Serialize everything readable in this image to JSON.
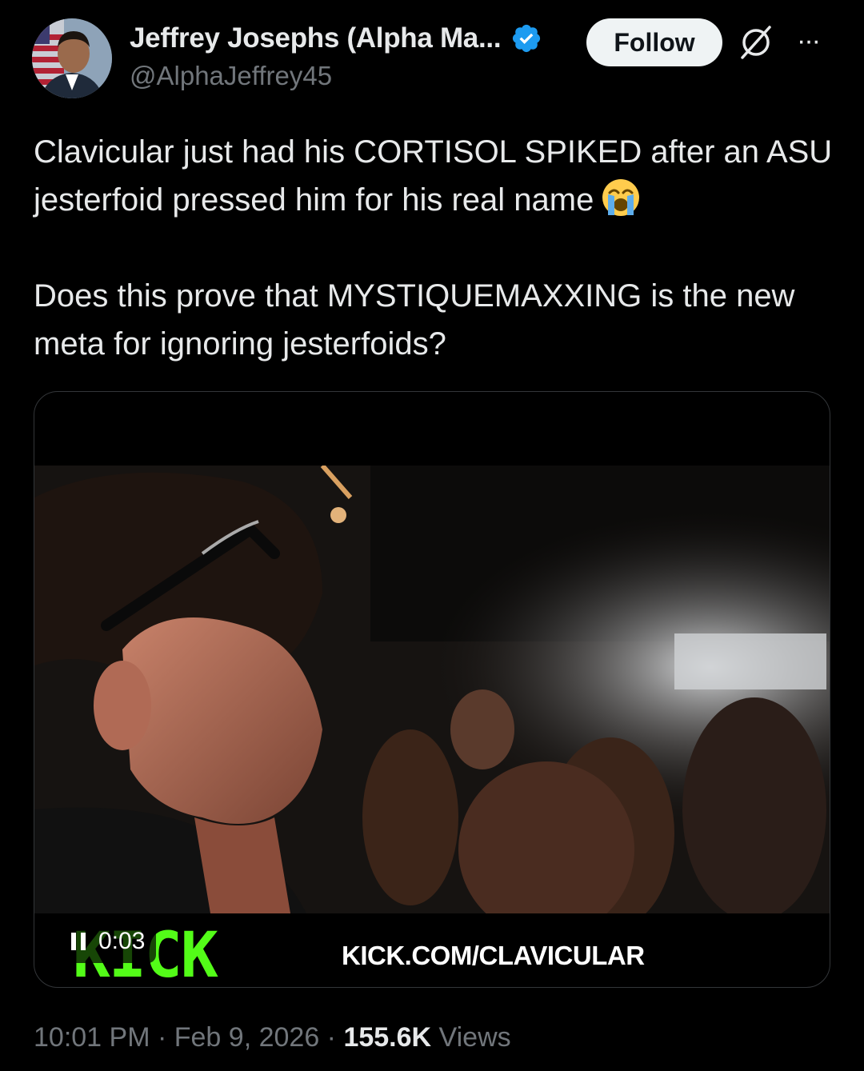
{
  "author": {
    "display_name": "Jeffrey Josephs (Alpha Ma...",
    "handle": "@AlphaJeffrey45",
    "verified_icon": "verified-badge-icon",
    "avatar_icon": "profile-avatar"
  },
  "header": {
    "follow_label": "Follow",
    "grok_icon": "grok-icon",
    "more_icon": "more-options-icon",
    "more_glyph": "···"
  },
  "tweet": {
    "paragraph_1": "Clavicular just had his CORTISOL SPIKED after an ASU jesterfoid pressed him for his real name",
    "paragraph_1_emoji": "loudly-crying-face-emoji",
    "paragraph_2": "Does this prove that MYSTIQUEMAXXING is the new meta for  ignoring jesterfoids?"
  },
  "media": {
    "type": "video",
    "timestamp": "0:03",
    "overlay_logo": "KICK",
    "overlay_url": "KICK.COM/CLAVICULAR",
    "playback_icon": "pause-icon"
  },
  "meta": {
    "time": "10:01 PM",
    "separator": " · ",
    "date": "Feb 9, 2026",
    "views_count": "155.6K",
    "views_label": "Views"
  },
  "colors": {
    "background": "#000000",
    "text_primary": "#e7e9ea",
    "text_secondary": "#71767b",
    "verified_blue": "#1d9bf0",
    "kick_green": "#53fc18",
    "follow_bg": "#eff3f4"
  }
}
